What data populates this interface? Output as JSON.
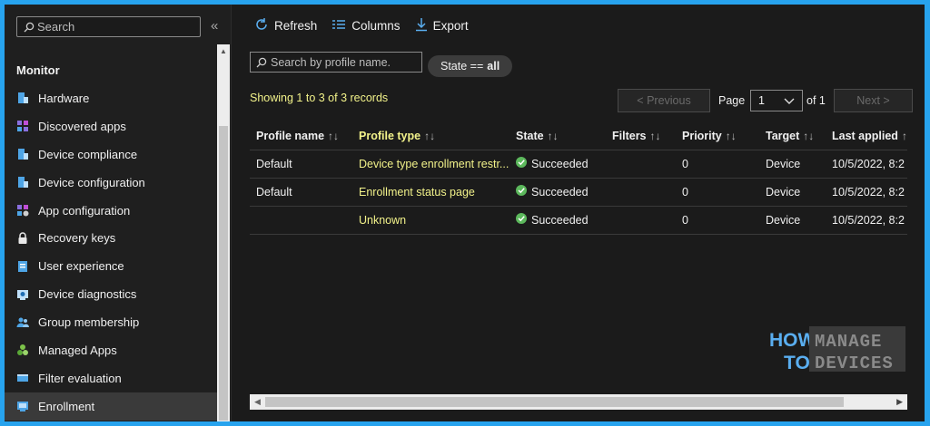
{
  "sidebar": {
    "search_placeholder": "Search",
    "collapse_glyph": "«",
    "section_heading": "Monitor",
    "items": [
      {
        "label": "Hardware",
        "icon": "hardware-icon"
      },
      {
        "label": "Discovered apps",
        "icon": "apps-grid-icon"
      },
      {
        "label": "Device compliance",
        "icon": "device-compliance-icon"
      },
      {
        "label": "Device configuration",
        "icon": "device-configuration-icon"
      },
      {
        "label": "App configuration",
        "icon": "app-configuration-icon"
      },
      {
        "label": "Recovery keys",
        "icon": "lock-icon"
      },
      {
        "label": "User experience",
        "icon": "user-experience-icon"
      },
      {
        "label": "Device diagnostics",
        "icon": "diagnostics-icon"
      },
      {
        "label": "Group membership",
        "icon": "group-icon"
      },
      {
        "label": "Managed Apps",
        "icon": "managed-apps-icon"
      },
      {
        "label": "Filter evaluation",
        "icon": "filter-evaluation-icon"
      },
      {
        "label": "Enrollment",
        "icon": "enrollment-icon",
        "active": true
      }
    ]
  },
  "toolbar": {
    "refresh_label": "Refresh",
    "columns_label": "Columns",
    "export_label": "Export"
  },
  "filter": {
    "search_placeholder": "Search by profile name.",
    "state_prefix": "State ==",
    "state_value": "all"
  },
  "records_text": "Showing 1 to 3 of 3 records",
  "pagination": {
    "previous_label": "< Previous",
    "page_label": "Page",
    "current_page": "1",
    "of_label": "of 1",
    "next_label": "Next >"
  },
  "table": {
    "columns": [
      "Profile name",
      "Profile type",
      "State",
      "Filters",
      "Priority",
      "Target",
      "Last applied"
    ],
    "rows": [
      {
        "profile_name": "Default",
        "profile_type": "Device type enrollment restr...",
        "state": "Succeeded",
        "filters": "",
        "priority": "0",
        "target": "Device",
        "last_applied": "10/5/2022, 8:2"
      },
      {
        "profile_name": "Default",
        "profile_type": "Enrollment status page",
        "state": "Succeeded",
        "filters": "",
        "priority": "0",
        "target": "Device",
        "last_applied": "10/5/2022, 8:2"
      },
      {
        "profile_name": "",
        "profile_type": "Unknown",
        "state": "Succeeded",
        "filters": "",
        "priority": "0",
        "target": "Device",
        "last_applied": "10/5/2022, 8:2"
      }
    ]
  },
  "watermark": {
    "line1_left": "HOW",
    "line2_left": "TO",
    "line1_right": "MANAGE",
    "line2_right": "DEVICES"
  },
  "colors": {
    "accent_border": "#27a3ee",
    "highlight_text": "#f2f28a",
    "success_green": "#5cb85c",
    "background": "#1b1b1b"
  }
}
